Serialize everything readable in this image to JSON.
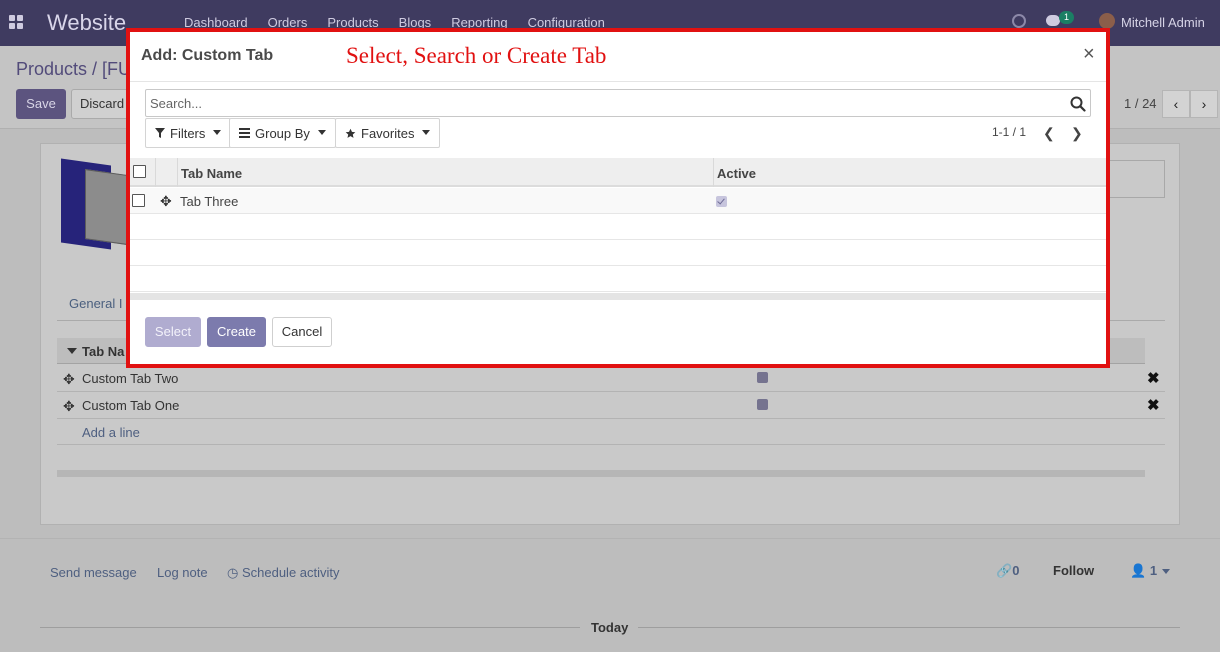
{
  "app": {
    "brand": "Website",
    "menu": [
      "Dashboard",
      "Orders",
      "Products",
      "Blogs",
      "Reporting",
      "Configuration"
    ],
    "chat_badge": "1",
    "user_name": "Mitchell Admin"
  },
  "control_panel": {
    "breadcrumb": "Products / [FU",
    "save_label": "Save",
    "discard_label": "Discard",
    "pager": "1 / 24"
  },
  "form": {
    "tab_general": "General I",
    "lines_header": "Tab Na",
    "lines": [
      {
        "name": "Custom Tab Two",
        "active": true
      },
      {
        "name": "Custom Tab One",
        "active": true
      }
    ],
    "add_line": "Add a line"
  },
  "chatter": {
    "send_message": "Send message",
    "log_note": "Log note",
    "schedule_activity": "Schedule activity",
    "attachments_count": "0",
    "follow": "Follow",
    "followers_count": "1",
    "today": "Today"
  },
  "modal": {
    "title": "Add: Custom Tab",
    "annotation": "Select, Search or Create Tab",
    "close": "×",
    "search_placeholder": "Search...",
    "filters_label": "Filters",
    "group_by_label": "Group By",
    "favorites_label": "Favorites",
    "pager": "1-1 / 1",
    "columns": {
      "name": "Tab Name",
      "active": "Active"
    },
    "rows": [
      {
        "name": "Tab Three",
        "active": true
      }
    ],
    "buttons": {
      "select": "Select",
      "create": "Create",
      "cancel": "Cancel"
    }
  },
  "colors": {
    "navbar": "#3f3b60",
    "primary": "#7c7bad",
    "annotation": "#e11111"
  }
}
